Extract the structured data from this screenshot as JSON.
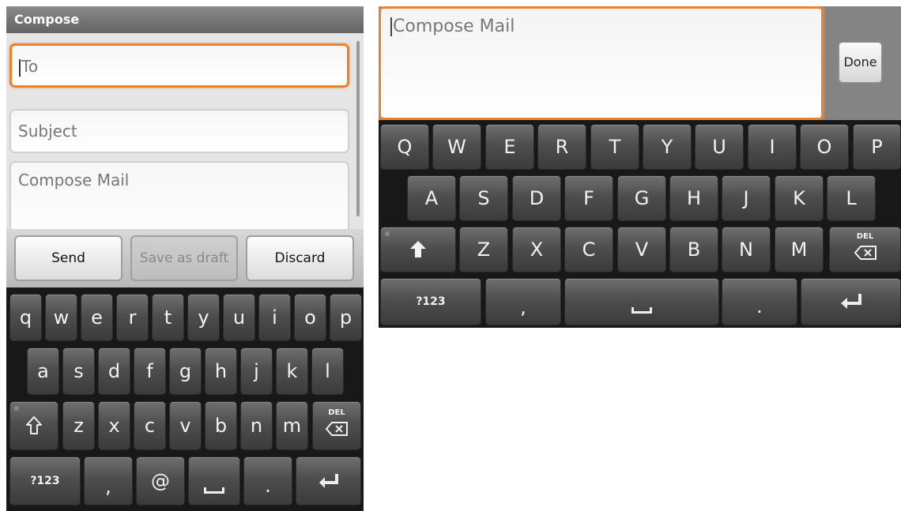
{
  "left": {
    "title": "Compose",
    "to_placeholder": "To",
    "subject_placeholder": "Subject",
    "body_placeholder": "Compose Mail",
    "buttons": {
      "send": "Send",
      "save_draft": "Save as draft",
      "discard": "Discard"
    },
    "keyboard": {
      "row1": [
        "q",
        "w",
        "e",
        "r",
        "t",
        "y",
        "u",
        "i",
        "o",
        "p"
      ],
      "row2": [
        "a",
        "s",
        "d",
        "f",
        "g",
        "h",
        "j",
        "k",
        "l"
      ],
      "row3": [
        "z",
        "x",
        "c",
        "v",
        "b",
        "n",
        "m"
      ],
      "del_label": "DEL",
      "symbols_label": "?123",
      "comma": ",",
      "at": "@",
      "period": "."
    }
  },
  "right": {
    "body_placeholder": "Compose Mail",
    "done_label": "Done",
    "keyboard": {
      "row1": [
        "Q",
        "W",
        "E",
        "R",
        "T",
        "Y",
        "U",
        "I",
        "O",
        "P"
      ],
      "row2": [
        "A",
        "S",
        "D",
        "F",
        "G",
        "H",
        "J",
        "K",
        "L"
      ],
      "row3": [
        "Z",
        "X",
        "C",
        "V",
        "B",
        "N",
        "M"
      ],
      "del_label": "DEL",
      "symbols_label": "?123",
      "comma": ",",
      "period": "."
    }
  },
  "colors": {
    "focus_orange": "#e8822e",
    "key_dark": "#4e4e4e",
    "keyboard_bg": "#181818"
  },
  "icons": [
    "shift-outline-icon",
    "shift-solid-icon",
    "backspace-icon",
    "enter-icon",
    "space-icon"
  ]
}
